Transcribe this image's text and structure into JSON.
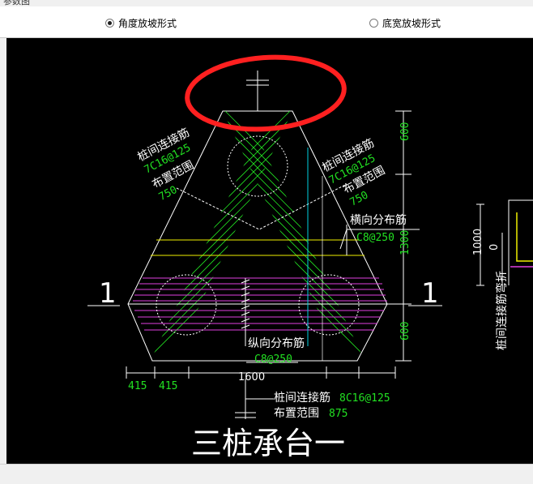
{
  "window": {
    "title": "参数图"
  },
  "options": [
    {
      "label": "角度放坡形式",
      "selected": true
    },
    {
      "label": "底宽放坡形式",
      "selected": false
    }
  ],
  "drawing": {
    "title": "三桩承台一",
    "section_mark": "1",
    "dims_right": [
      "600",
      "1300",
      "600"
    ],
    "dim_bottom_total": "1600",
    "dim_bottom_left": [
      "415",
      "415"
    ],
    "label_left_1": "桩间连接筋",
    "label_left_2": "7C16@125",
    "label_left_3": "布置范围",
    "label_left_4": "750",
    "label_right_1": "桩间连接筋",
    "label_right_2": "7C16@125",
    "label_right_3": "布置范围",
    "label_right_4": "750",
    "transverse_label": "横向分布筋",
    "transverse_value": "C8@250",
    "longitudinal_label": "纵向分布筋",
    "longitudinal_value": "C8@250",
    "bottom_label_1": "桩间连接筋",
    "bottom_value_1": "8C16@125",
    "bottom_label_2": "布置范围",
    "bottom_value_2": "875",
    "side_dims": [
      "1000",
      "0"
    ],
    "side_label": "桩间连接筋弯折"
  },
  "colors": {
    "background": "#000000",
    "rebar": "#22e022",
    "magenta": "#e040e0",
    "yellow": "#f0f000",
    "cyan": "#00d0e0",
    "annotation_circle": "#ff2020"
  }
}
